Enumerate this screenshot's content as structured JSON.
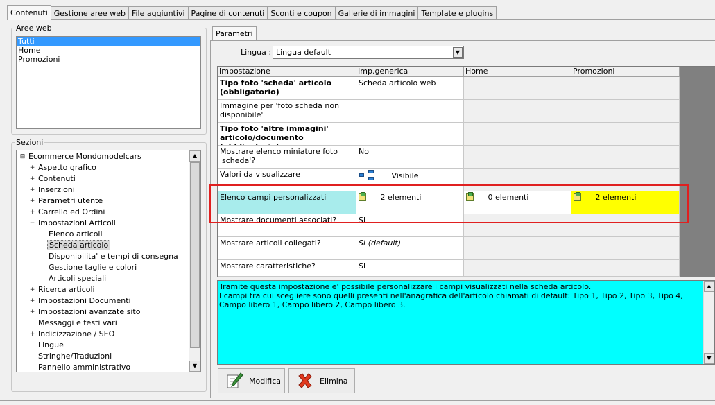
{
  "tabs": [
    "Contenuti",
    "Gestione aree web",
    "File aggiuntivi",
    "Pagine di contenuti",
    "Sconti e coupon",
    "Gallerie di immagini",
    "Template e plugins"
  ],
  "areas": {
    "legend": "Aree web",
    "items": [
      "Tutti",
      "Home",
      "Promozioni"
    ]
  },
  "sections": {
    "legend": "Sezioni",
    "root": "Ecommerce Mondomodelcars",
    "items": [
      "Aspetto grafico",
      "Contenuti",
      "Inserzioni",
      "Parametri utente",
      "Carrello ed Ordini",
      "Impostazioni Articoli",
      "Elenco articoli",
      "Scheda articolo",
      "Disponibilita' e tempi di consegna",
      "Gestione taglie e colori",
      "Articoli speciali",
      "Ricerca articoli",
      "Impostazioni Documenti",
      "Impostazioni avanzate sito",
      "Messaggi e testi vari",
      "Indicizzazione / SEO",
      "Lingue",
      "Stringhe/Traduzioni",
      "Pannello amministrativo"
    ]
  },
  "params": {
    "tab": "Parametri",
    "lingua_label": "Lingua :",
    "lingua_value": "Lingua default"
  },
  "grid": {
    "headers": [
      "Impostazione",
      "Imp.generica",
      "Home",
      "Promozioni"
    ],
    "rows": [
      {
        "name": "Tipo foto 'scheda' articolo (obbligatorio)",
        "generic": "Scheda articolo web",
        "home": "",
        "promo": ""
      },
      {
        "name": "Immagine per 'foto scheda non disponibile'",
        "generic": "",
        "home": "",
        "promo": ""
      },
      {
        "name": "Tipo foto 'altre immagini' articolo/documento (obbligatorio)",
        "generic": "",
        "home": "",
        "promo": ""
      },
      {
        "name": "Mostrare elenco miniature foto 'scheda'?",
        "generic": "No",
        "home": "",
        "promo": ""
      },
      {
        "name": "Valori da visualizzare",
        "generic": "Visibile",
        "home": "",
        "promo": ""
      },
      {
        "name": "Elenco campi personalizzati",
        "generic": "2 elementi",
        "home": "0 elementi",
        "promo": "2 elementi"
      },
      {
        "name": "Mostrare documenti associati?",
        "generic": "Si",
        "home": "",
        "promo": ""
      },
      {
        "name": "Mostrare articoli collegati?",
        "generic": "SI (default)",
        "home": "",
        "promo": ""
      },
      {
        "name": "Mostrare caratteristiche?",
        "generic": "Si",
        "home": "",
        "promo": ""
      }
    ]
  },
  "description": "Tramite questa impostazione e' possibile personalizzare i campi visualizzati nella scheda articolo.\nI campi tra cui scegliere sono quelli presenti nell'anagrafica dell'articolo chiamati di default: Tipo 1, Tipo 2, Tipo 3, Tipo 4, Campo libero 1, Campo libero 2, Campo libero 3.",
  "buttons": {
    "edit": "Modifica",
    "delete": "Elimina"
  },
  "colors": {
    "highlight": "#e02020",
    "memo": "#00ffff",
    "selected_cell": "#a8ecec",
    "promo_cell": "#ffff00"
  }
}
